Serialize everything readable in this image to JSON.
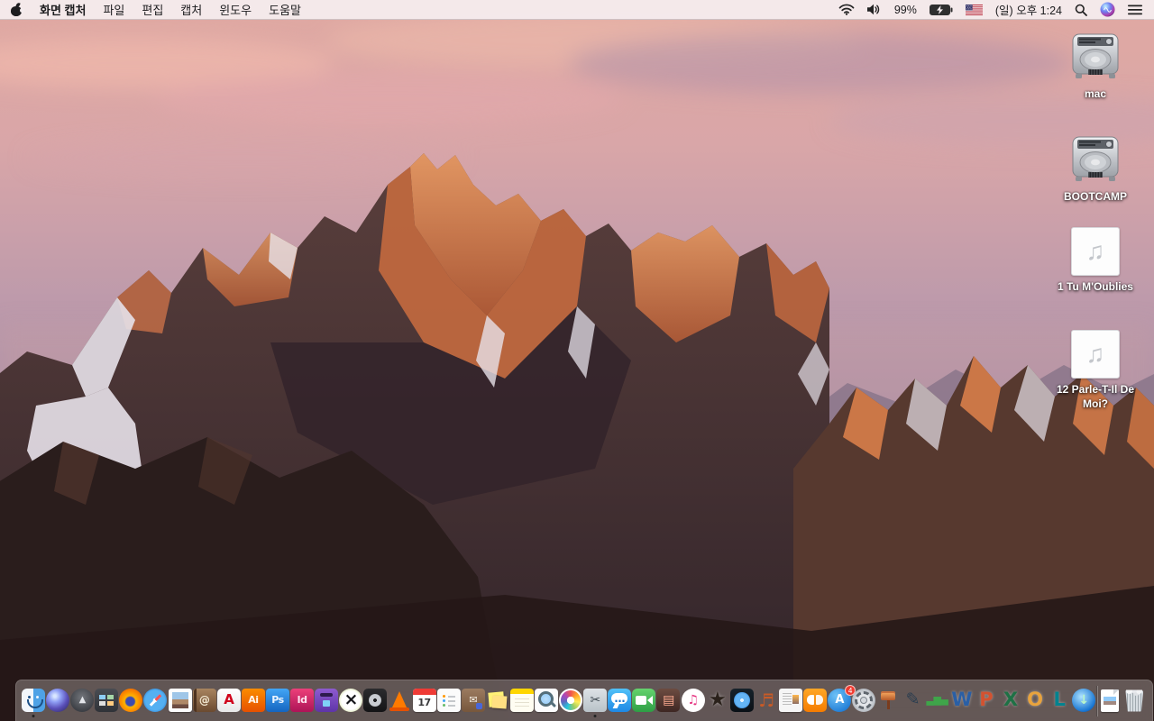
{
  "menu_bar": {
    "apple_menu": "apple-logo",
    "app_name": "화면 캡처",
    "menus": [
      "파일",
      "편집",
      "캡처",
      "윈도우",
      "도움말"
    ],
    "status": {
      "wifi_icon": "wifi",
      "volume_icon": "volume-on",
      "battery_percent": "99%",
      "battery_state": "charging",
      "input_source": "us-flag",
      "clock": "(일) 오후 1:24",
      "spotlight_icon": "magnifier",
      "siri_icon": "siri-orb",
      "notification_center_icon": "list-lines"
    }
  },
  "desktop": {
    "icons": [
      {
        "label": "mac",
        "type": "hard-drive"
      },
      {
        "label": "BOOTCAMP",
        "type": "hard-drive"
      },
      {
        "label": "1 Tu M'Oublies",
        "type": "audio-file",
        "glyph": "♫"
      },
      {
        "label": "12 Parle-T-Il De Moi?",
        "type": "audio-file",
        "glyph": "♫"
      }
    ]
  },
  "dock": {
    "items": [
      {
        "name": "finder",
        "kind": "finder",
        "running": true
      },
      {
        "name": "siri",
        "kind": "siri"
      },
      {
        "name": "launchpad",
        "kind": "launchpad",
        "glyph": "▲",
        "color": "#e3e6eb",
        "fs": 10
      },
      {
        "name": "mission-control",
        "kind": "mc"
      },
      {
        "name": "firefox",
        "kind": "firefox"
      },
      {
        "name": "safari",
        "kind": "safari"
      },
      {
        "name": "image-viewer",
        "kind": "photo"
      },
      {
        "name": "address-book",
        "kind": "addressbook",
        "glyph": "@",
        "color": "#f3e9d2",
        "fs": 12,
        "bold": true
      },
      {
        "name": "adobe-reader",
        "glyph": "A",
        "bg": "linear-gradient(#ffffff,#e8e8e8)",
        "color": "#d0021b",
        "fs": 15,
        "bold": true,
        "radius": 5
      },
      {
        "name": "illustrator",
        "glyph": "Ai",
        "bg": "linear-gradient(#fb8c00,#e65100)",
        "color": "#fff7ee",
        "fs": 11,
        "bold": true,
        "radius": 4
      },
      {
        "name": "photoshop",
        "glyph": "Ps",
        "bg": "linear-gradient(#42a5f5,#1565c0)",
        "color": "#eaf4ff",
        "fs": 11,
        "bold": true,
        "radius": 4
      },
      {
        "name": "indesign",
        "glyph": "Id",
        "bg": "linear-gradient(#ec407a,#ad1457)",
        "color": "#ffe3ef",
        "fs": 11,
        "bold": true,
        "radius": 4
      },
      {
        "name": "toast",
        "kind": "toast"
      },
      {
        "name": "x-utility",
        "glyph": "×",
        "bg": "radial-gradient(circle,#ffffff 0 55%,#b9d06a 100%)",
        "color": "#15161a",
        "fs": 19,
        "bold": true,
        "shape": "circle"
      },
      {
        "name": "disk-tool",
        "kind": "disk"
      },
      {
        "name": "vlc",
        "kind": "cone"
      },
      {
        "name": "calendar",
        "kind": "cal",
        "glyph": "17",
        "color": "#3a3a3c",
        "fs": 11,
        "bold": true
      },
      {
        "name": "reminders",
        "kind": "rem"
      },
      {
        "name": "mail-archiver",
        "kind": "boxapp",
        "glyph": "✉",
        "color": "#f7f2e8",
        "fs": 11
      },
      {
        "name": "stickies",
        "kind": "stickies"
      },
      {
        "name": "notes",
        "kind": "notes"
      },
      {
        "name": "preview",
        "kind": "loupe"
      },
      {
        "name": "photos",
        "kind": "photos"
      },
      {
        "name": "grab-screen-capture",
        "kind": "grab",
        "glyph": "✂",
        "color": "#3f4a52",
        "fs": 14,
        "running": true
      },
      {
        "name": "messages",
        "kind": "bubble",
        "glyph": "…",
        "color": "#1976d2",
        "fs": 12,
        "bold": true
      },
      {
        "name": "facetime",
        "kind": "cam"
      },
      {
        "name": "photo-booth",
        "kind": "booth",
        "glyph": "▤",
        "color": "#ffab91",
        "fs": 14
      },
      {
        "name": "itunes",
        "glyph": "♫",
        "bg": "#ffffff",
        "color": "#e5317f",
        "fs": 14,
        "shape": "circle"
      },
      {
        "name": "imovie",
        "glyph": "★",
        "color": "#2a211b",
        "fs": 22,
        "shadow": true
      },
      {
        "name": "dvd-player-app",
        "kind": "dvd"
      },
      {
        "name": "garageband",
        "glyph": "♬",
        "color": "#c75b28",
        "fs": 20
      },
      {
        "name": "iweb",
        "kind": "iweb"
      },
      {
        "name": "ibooks",
        "kind": "book"
      },
      {
        "name": "app-store",
        "kind": "appstore",
        "glyph": "A",
        "color": "#ffffff",
        "fs": 13,
        "bold": true,
        "badge": "4"
      },
      {
        "name": "system-preferences",
        "kind": "gear"
      },
      {
        "name": "keynote",
        "kind": "podium"
      },
      {
        "name": "pages",
        "glyph": "✎",
        "color": "#2c3e50",
        "fs": 19
      },
      {
        "name": "numbers",
        "glyph": "▃▆▄",
        "color": "#3fa54a",
        "fs": 11,
        "bold": true
      },
      {
        "name": "word",
        "glyph": "W",
        "color": "#2a5fa5",
        "fs": 21,
        "bold": true,
        "shadow": true
      },
      {
        "name": "powerpoint",
        "glyph": "P",
        "color": "#d35230",
        "fs": 21,
        "bold": true,
        "shadow": true
      },
      {
        "name": "excel",
        "glyph": "X",
        "color": "#1e7145",
        "fs": 21,
        "bold": true,
        "shadow": true
      },
      {
        "name": "outlook",
        "glyph": "O",
        "color": "#e8a33d",
        "fs": 21,
        "bold": true,
        "shadow": true
      },
      {
        "name": "lync",
        "glyph": "L",
        "color": "#00838f",
        "fs": 21,
        "bold": true,
        "shadow": true
      },
      {
        "name": "download-manager",
        "kind": "globe",
        "glyph": "↓",
        "color": "#b9f6ca",
        "fs": 14,
        "bold": true
      },
      {
        "divider": true
      },
      {
        "name": "image-document",
        "kind": "doc"
      },
      {
        "name": "trash-full",
        "kind": "trash"
      }
    ]
  },
  "colors": {
    "menubar_bg": "#f4ecee",
    "dock_bg": "rgba(148,139,137,0.55)",
    "sky_pink": "#dca9a6",
    "sky_purple": "#90809e",
    "sunlit_rock": "#c96f45",
    "shadow_rock": "#33232a"
  }
}
